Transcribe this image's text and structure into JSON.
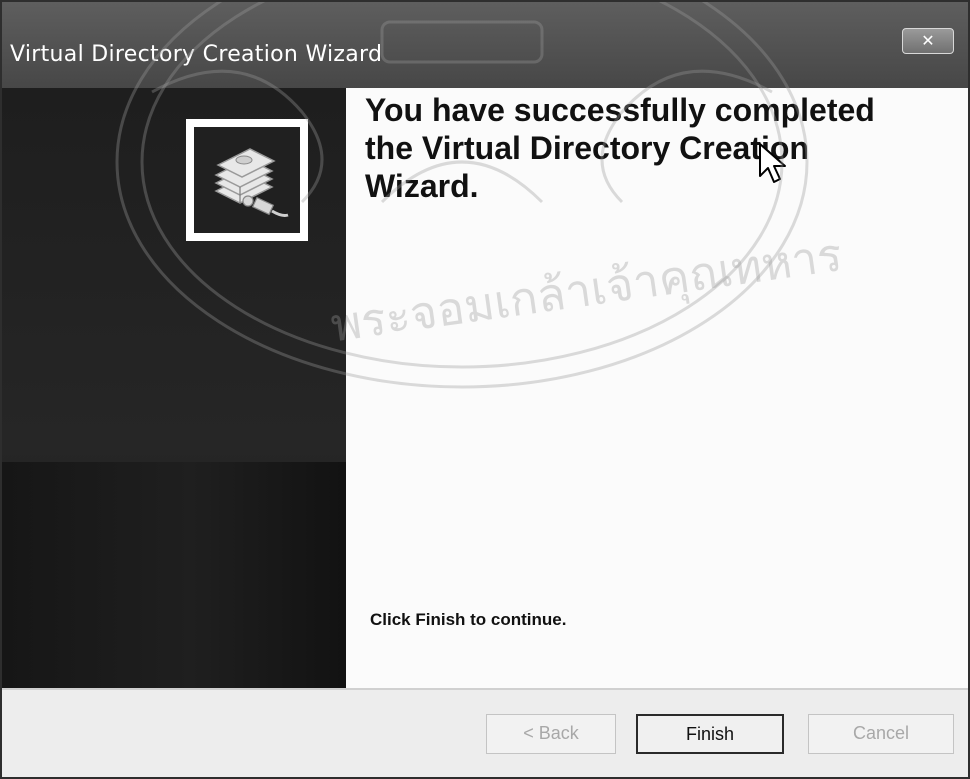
{
  "window": {
    "title": "Virtual Directory Creation Wizard",
    "close_glyph": "✕"
  },
  "banner": {
    "icon": "folder-network-icon"
  },
  "content": {
    "heading": "You have successfully completed the Virtual Directory Creation Wizard.",
    "instruction": "Click Finish to continue."
  },
  "buttons": {
    "back_label": "< Back",
    "finish_label": "Finish",
    "cancel_label": "Cancel"
  },
  "watermark": {
    "text": "พระจอมเกล้าเจ้าคุณทหาร"
  },
  "colors": {
    "banner": "#1e1e1e",
    "content_bg": "#fbfbfb",
    "titlebar": "#4f4f4f",
    "button_bar": "#ededed"
  }
}
